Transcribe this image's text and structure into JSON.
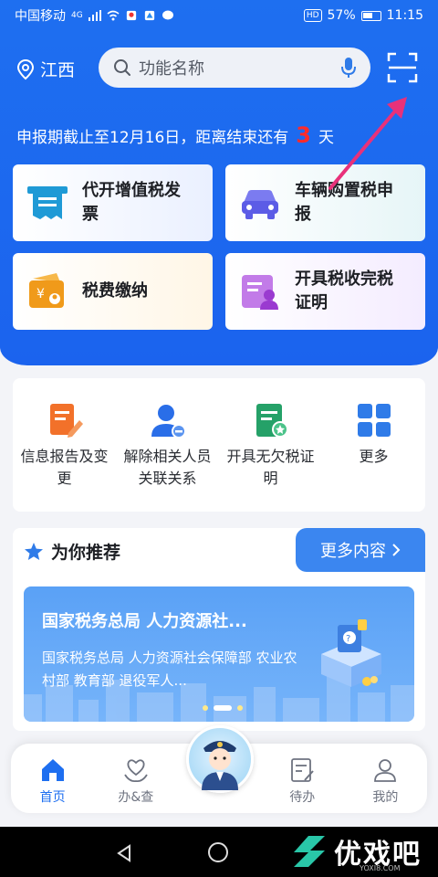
{
  "status_bar": {
    "carrier": "中国移动",
    "network": "4G",
    "battery": "57%",
    "time": "11:15",
    "hd": "HD"
  },
  "header": {
    "location": "江西",
    "search_placeholder": "功能名称"
  },
  "deadline": {
    "prefix": "申报期截止至12月16日，距离结束还有",
    "days": "3",
    "suffix": "天"
  },
  "feature_cards": [
    {
      "label_line1": "代开增值税发",
      "label_line2": "票",
      "icon": "invoice-icon",
      "color": "#1f9ad6"
    },
    {
      "label_line1": "车辆购置税申",
      "label_line2": "报",
      "icon": "car-icon",
      "color": "#5c5ce6"
    },
    {
      "label_line1": "税费缴纳",
      "label_line2": "",
      "icon": "wallet-icon",
      "color": "#f09a1a"
    },
    {
      "label_line1": "开具税收完税",
      "label_line2": "证明",
      "icon": "certificate-icon",
      "color": "#b04ad6"
    }
  ],
  "quick_actions": [
    {
      "label": "信息报告及变更",
      "icon": "report-edit-icon",
      "color": "#f2712a"
    },
    {
      "label": "解除相关人员关联关系",
      "icon": "user-remove-icon",
      "color": "#2a6ee8"
    },
    {
      "label": "开具无欠税证明",
      "icon": "certificate-star-icon",
      "color": "#25a168"
    },
    {
      "label": "更多",
      "icon": "grid-icon",
      "color": "#2f7be8"
    }
  ],
  "recommend": {
    "title": "为你推荐",
    "more": "更多内容",
    "banner_title": "国家税务总局 人力资源社...",
    "banner_desc": "国家税务总局 人力资源社会保障部 农业农村部 教育部 退役军人..."
  },
  "tabbar": [
    {
      "label": "首页",
      "icon": "home-icon",
      "active": true
    },
    {
      "label": "办&查",
      "icon": "heart-hand-icon",
      "active": false
    },
    {
      "label": "待办",
      "icon": "todo-icon",
      "active": false
    },
    {
      "label": "我的",
      "icon": "profile-icon",
      "active": false
    }
  ],
  "watermark": {
    "text": "优戏吧",
    "url": "YOXI8.COM"
  },
  "colors": {
    "primary": "#1e6ff0",
    "deadline_number": "#ff2b2b",
    "annotation_arrow": "#e8317a"
  }
}
